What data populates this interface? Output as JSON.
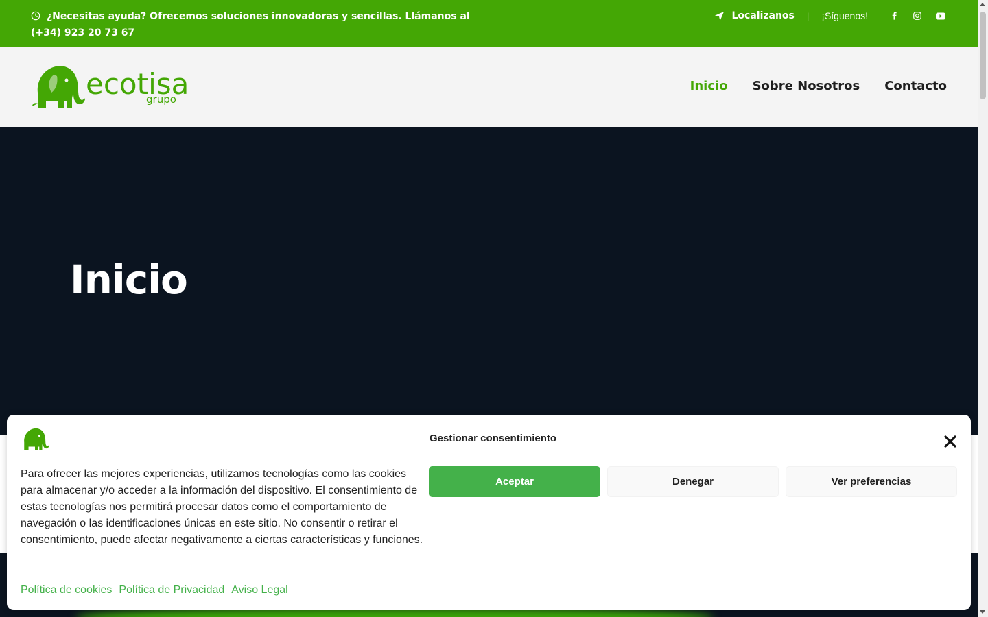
{
  "topbar": {
    "help_text": "¿Necesitas ayuda? Ofrecemos soluciones innovadoras y sencillas. Llámanos al (+34) 923 20 73 67",
    "locate_label": "Localizanos",
    "separator": "|",
    "follow_label": "¡Síguenos!",
    "socials": [
      "facebook-icon",
      "instagram-icon",
      "youtube-icon"
    ]
  },
  "header": {
    "logo_word": "ecotisa",
    "logo_sub": "grupo",
    "nav": [
      {
        "label": "Inicio",
        "active": true
      },
      {
        "label": "Sobre Nosotros",
        "active": false
      },
      {
        "label": "Contacto",
        "active": false
      }
    ]
  },
  "hero": {
    "title": "Inicio"
  },
  "consent": {
    "title": "Gestionar consentimiento",
    "message": "Para ofrecer las mejores experiencias, utilizamos tecnologías como las cookies para almacenar y/o acceder a la información del dispositivo. El consentimiento de estas tecnologías nos permitirá procesar datos como el comportamiento de navegación o las identificaciones únicas en este sitio. No consentir o retirar el consentimiento, puede afectar negativamente a ciertas características y funciones.",
    "accept_label": "Aceptar",
    "deny_label": "Denegar",
    "prefs_label": "Ver preferencias",
    "links": [
      "Política de cookies",
      "Política de Privacidad",
      "Aviso Legal"
    ]
  },
  "colors": {
    "brand_green": "#44a705",
    "consent_green": "#44b14a",
    "hero_bg": "#0b1420",
    "header_bg": "#f4f4f4"
  }
}
